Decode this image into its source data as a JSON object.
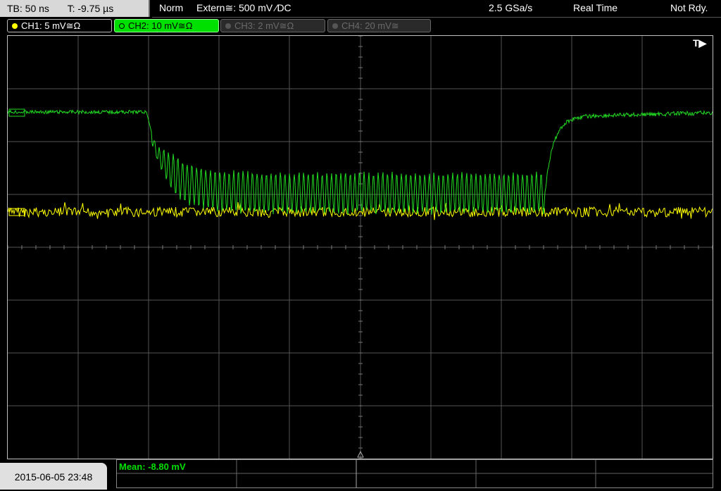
{
  "header": {
    "timebase": "TB: 50 ns",
    "trigger_time": "T: -9.75 µs",
    "trigger_mode": "Norm",
    "trigger_source": "Extern≅: 500 mV ⁄DC",
    "sample_rate": "2.5 GSa/s",
    "acq_mode": "Real Time",
    "state": "Not Rdy."
  },
  "channels": [
    {
      "label": "CH1: 5 mV≅Ω",
      "color": "#ffff00"
    },
    {
      "label": "CH2: 10 mV≅Ω",
      "color": "#00e000"
    },
    {
      "label": "CH3: 2 mV≅Ω",
      "color": "#6a6a6a"
    },
    {
      "label": "CH4: 20 mV≅",
      "color": "#6a6a6a"
    }
  ],
  "trigger_marker": "T▶",
  "measurement": {
    "label": "Mean: -8.80 mV"
  },
  "datetime": "2015-06-05 23:48",
  "colors": {
    "ch1": "#ffff00",
    "ch2": "#22dd22",
    "grid": "#555555"
  }
}
